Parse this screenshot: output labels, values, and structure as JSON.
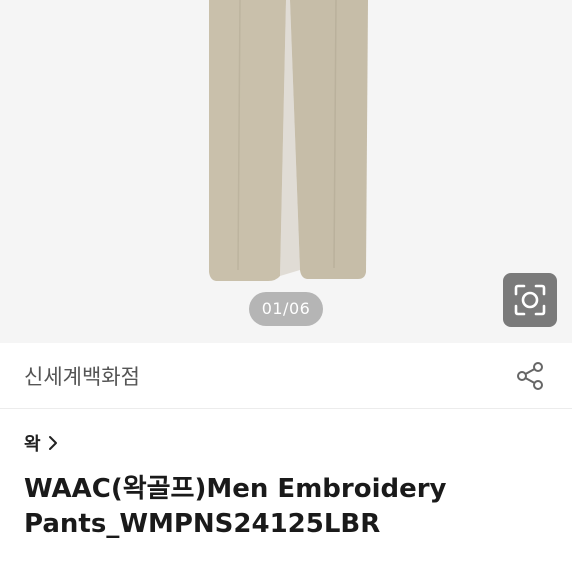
{
  "image_counter": "01/06",
  "store": {
    "name": "신세계백화점"
  },
  "brand": {
    "label": "왁"
  },
  "product": {
    "title_line1": "WAAC(왁골프)Men Embroidery",
    "title_line2": "Pants_WMPNS24125LBR"
  },
  "icons": {
    "lens": "image-search-icon",
    "share": "share-icon",
    "brand_chevron": "chevron-right-icon"
  },
  "colors": {
    "hero_background": "#f5f5f5",
    "pants": "#c9c0ab",
    "text_primary": "#1a1a1a",
    "text_secondary": "#555555"
  }
}
